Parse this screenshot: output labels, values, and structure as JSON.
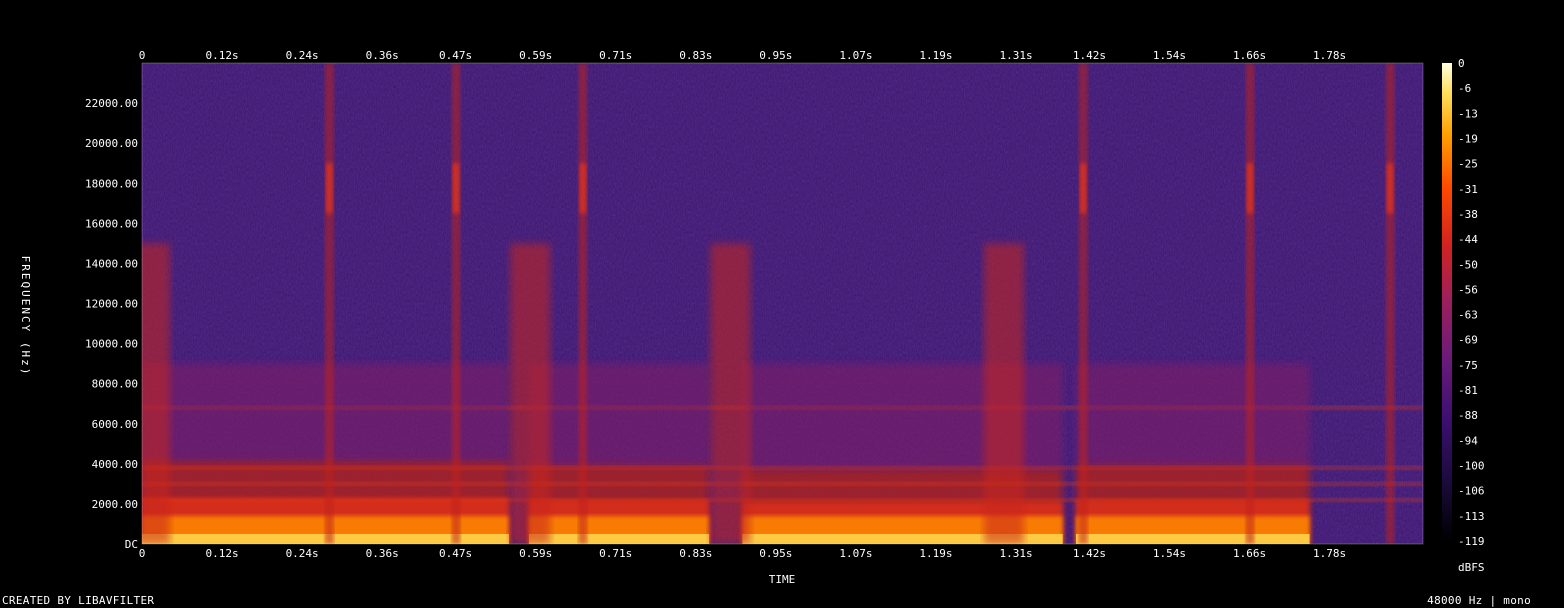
{
  "chart_data": {
    "type": "heatmap",
    "title": "",
    "xlabel": "TIME",
    "ylabel": "FREQUENCY (Hz)",
    "x_ticks": [
      "0",
      "0.12s",
      "0.24s",
      "0.36s",
      "0.47s",
      "0.59s",
      "0.71s",
      "0.83s",
      "0.95s",
      "1.07s",
      "1.19s",
      "1.31s",
      "1.42s",
      "1.54s",
      "1.66s",
      "1.78s"
    ],
    "x_tick_values": [
      0,
      0.12,
      0.24,
      0.36,
      0.47,
      0.59,
      0.71,
      0.83,
      0.95,
      1.07,
      1.19,
      1.31,
      1.42,
      1.54,
      1.66,
      1.78
    ],
    "xlim": [
      0,
      1.92
    ],
    "y_ticks": [
      "DC",
      "2000.00",
      "4000.00",
      "6000.00",
      "8000.00",
      "10000.00",
      "12000.00",
      "14000.00",
      "16000.00",
      "18000.00",
      "20000.00",
      "22000.00"
    ],
    "y_tick_values": [
      0,
      2000,
      4000,
      6000,
      8000,
      10000,
      12000,
      14000,
      16000,
      18000,
      20000,
      22000
    ],
    "ylim": [
      0,
      24000
    ],
    "colorbar": {
      "label": "dBFS",
      "ticks": [
        "0",
        "-6",
        "-13",
        "-19",
        "-25",
        "-31",
        "-38",
        "-44",
        "-50",
        "-56",
        "-63",
        "-69",
        "-75",
        "-81",
        "-88",
        "-94",
        "-100",
        "-106",
        "-113",
        "-119"
      ],
      "range": [
        -119,
        0
      ]
    },
    "colormap": [
      "#000000",
      "#1a0b3a",
      "#3b0f6f",
      "#6a1b7a",
      "#9b1f5e",
      "#d2231f",
      "#ff4a00",
      "#ffa000",
      "#ffe060",
      "#ffffe0"
    ],
    "onsets_s": [
      0.0,
      0.57,
      0.87,
      1.28
    ],
    "transients_s": [
      0.28,
      0.47,
      0.66,
      1.41,
      1.66,
      1.87
    ],
    "voiced_segments": [
      {
        "t0": 0.0,
        "t1": 0.55,
        "f_top": 4200
      },
      {
        "t0": 0.58,
        "t1": 0.85,
        "f_top": 4000
      },
      {
        "t0": 0.9,
        "t1": 1.38,
        "f_top": 3800
      },
      {
        "t0": 1.4,
        "t1": 1.75,
        "f_top": 4000
      }
    ]
  },
  "footer": {
    "credit": "CREATED BY LIBAVFILTER",
    "meta": "48000 Hz | mono"
  }
}
